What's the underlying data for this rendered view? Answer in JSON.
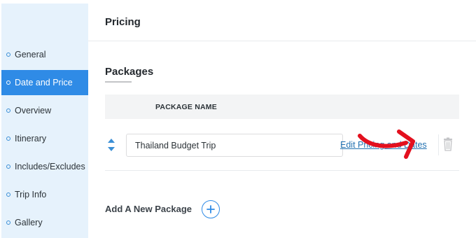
{
  "sidebar": {
    "items": [
      {
        "label": "General"
      },
      {
        "label": "Date and Price"
      },
      {
        "label": "Overview"
      },
      {
        "label": "Itinerary"
      },
      {
        "label": "Includes/Excludes"
      },
      {
        "label": "Trip Info"
      },
      {
        "label": "Gallery"
      }
    ],
    "active_item": "Date and Price"
  },
  "header": {
    "title": "Pricing"
  },
  "packages": {
    "section_title": "Packages",
    "column_header": "PACKAGE NAME",
    "rows": [
      {
        "name": "Thailand Budget Trip",
        "edit_link": "Edit Pricing and Dates"
      }
    ],
    "add_label": "Add A New Package"
  },
  "icons": {
    "sort": "sort-arrows-icon",
    "delete": "trash-icon",
    "add": "plus-circle-icon",
    "annotation": "red-arrow-annotation"
  },
  "colors": {
    "accent": "#2f8be6",
    "sidebar_bg": "#e6f2fc",
    "link": "#2271b1",
    "annotation": "#e3101e"
  }
}
